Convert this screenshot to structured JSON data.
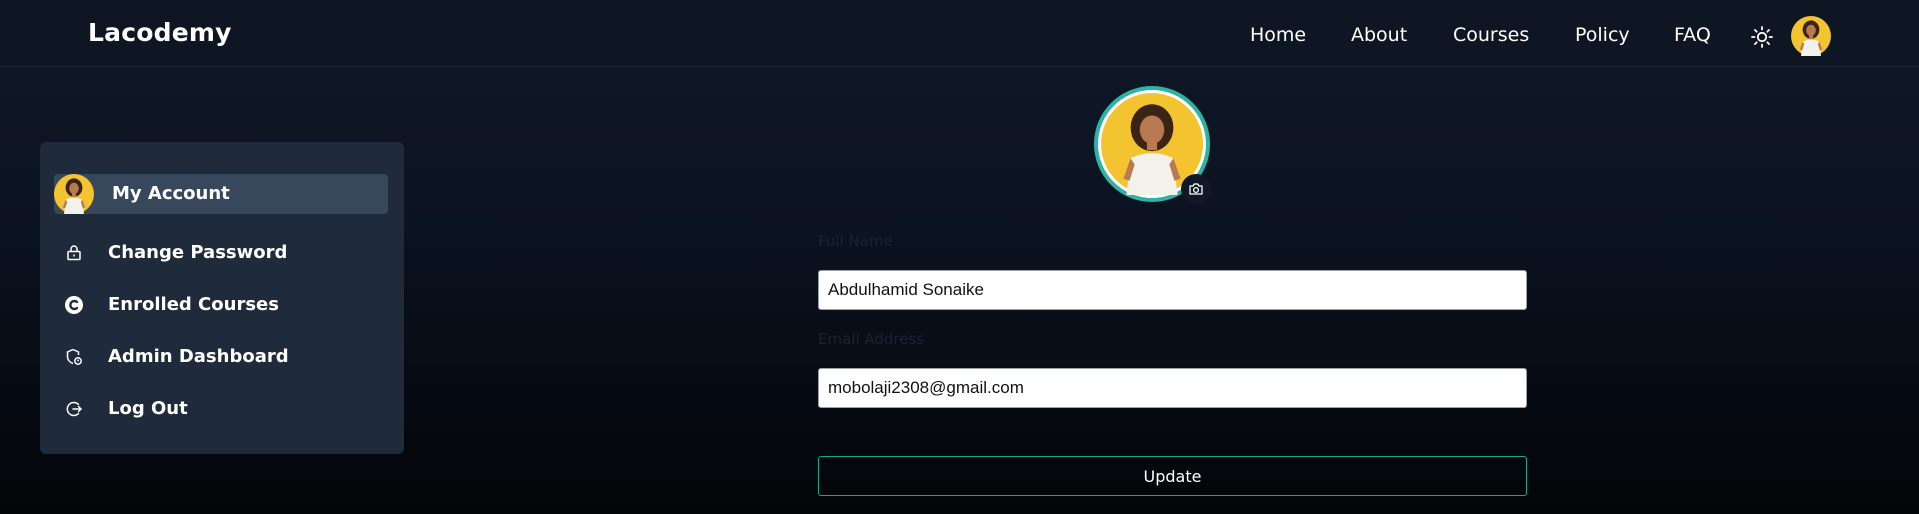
{
  "brand": "Lacodemy",
  "nav": {
    "links": [
      "Home",
      "About",
      "Courses",
      "Policy",
      "FAQ"
    ],
    "theme_icon": "sun-icon",
    "avatar_icon": "user-avatar"
  },
  "sidebar": {
    "items": [
      {
        "label": "My Account",
        "icon": "user-avatar",
        "active": true
      },
      {
        "label": "Change Password",
        "icon": "lock-icon"
      },
      {
        "label": "Enrolled Courses",
        "icon": "courses-icon"
      },
      {
        "label": "Admin Dashboard",
        "icon": "admin-badge-icon"
      },
      {
        "label": "Log Out",
        "icon": "logout-icon"
      }
    ]
  },
  "profile": {
    "avatar_icon": "user-avatar",
    "camera_icon": "camera-icon",
    "full_name_label": "Full Name",
    "full_name_value": "Abdulhamid Sonaike",
    "email_label": "Email Address",
    "email_value": "mobolaji2308@gmail.com",
    "update_label": "Update"
  },
  "colors": {
    "accent": "#14a98f",
    "avatar_ring": "#2bb3a3",
    "avatar_bg": "#f4c430",
    "sidebar_bg": "#1f2a3a",
    "sidebar_active": "#37475c"
  }
}
